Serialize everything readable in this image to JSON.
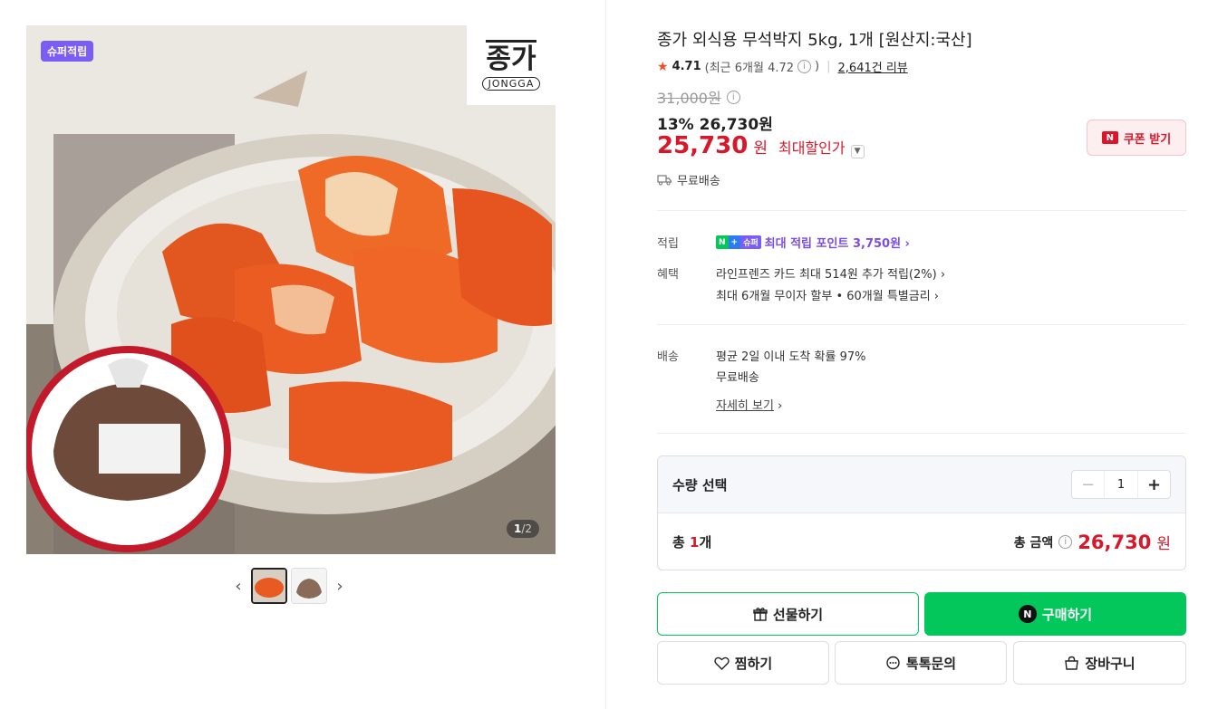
{
  "gallery": {
    "badge": "슈퍼적립",
    "brand_hangul": "종가",
    "brand_latin": "JONGGA",
    "counter_current": "1",
    "counter_total": "/2",
    "prev_arrow": "‹",
    "next_arrow": "›"
  },
  "product": {
    "title": "종가 외식용 무석박지 5kg, 1개 [원산지:국산]",
    "rating_star": "★",
    "rating": "4.71",
    "recent_rating": "(최근 6개월 4.72",
    "recent_close": ")",
    "reviews": "2,641건 리뷰",
    "original_price": "31,000원",
    "discount_line": "13% 26,730원",
    "max_price": "25,730",
    "max_price_unit": "원",
    "max_label": "최대할인가",
    "free_shipping": "무료배송",
    "coupon_label": "쿠폰 받기"
  },
  "details": {
    "points_label": "적립",
    "points_text": "최대 적립 포인트 3,750원 ›",
    "points_badge": [
      "N",
      "+",
      "슈퍼"
    ],
    "benefit_label": "혜택",
    "benefit_1": "라인프렌즈 카드 최대 514원 추가 적립(2%) ›",
    "benefit_2": "최대 6개월 무이자 할부 • 60개월 특별금리 ›",
    "delivery_label": "배송",
    "delivery_1": "평균 2일 이내 도착 확률 97%",
    "delivery_2": "무료배송",
    "delivery_more": "자세히 보기",
    "delivery_more_arrow": "›"
  },
  "quantity": {
    "label": "수량 선택",
    "value": "1",
    "minus": "−",
    "plus": "+",
    "count_prefix": "총 ",
    "count_num": "1",
    "count_suffix": "개",
    "total_label": "총 금액",
    "total_price": "26,730",
    "total_unit": "원"
  },
  "actions": {
    "gift": "선물하기",
    "buy": "구매하기",
    "zzim": "찜하기",
    "talk": "톡톡문의",
    "cart": "장바구니"
  },
  "colors": {
    "accent_red": "#d9172b",
    "naver_green": "#03c75a",
    "super_purple": "#7b5cf5"
  }
}
